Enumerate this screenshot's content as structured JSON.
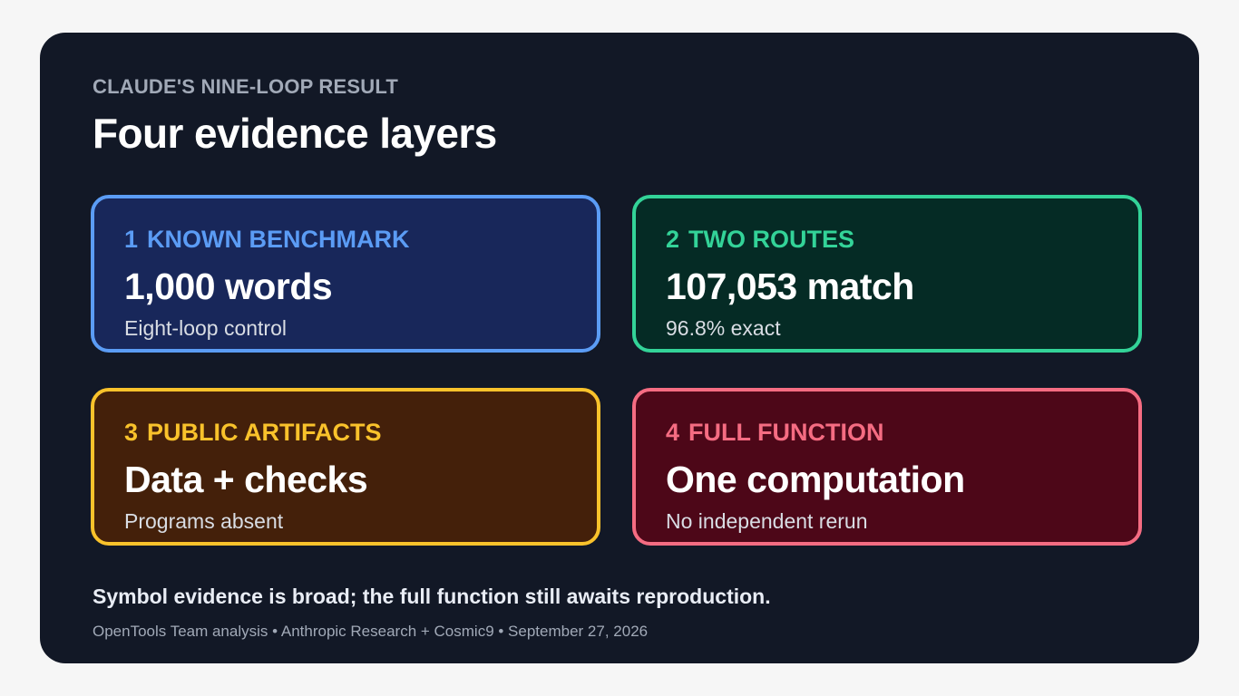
{
  "header": {
    "eyebrow": "CLAUDE'S NINE-LOOP RESULT",
    "title": "Four evidence layers"
  },
  "cards": [
    {
      "number": "1",
      "label": "KNOWN BENCHMARK",
      "value": "1,000 words",
      "note": "Eight-loop control",
      "accent": "#5b9cf5"
    },
    {
      "number": "2",
      "label": "TWO ROUTES",
      "value": "107,053 match",
      "note": "96.8% exact",
      "accent": "#33d398"
    },
    {
      "number": "3",
      "label": "PUBLIC ARTIFACTS",
      "value": "Data + checks",
      "note": "Programs absent",
      "accent": "#f9c22b"
    },
    {
      "number": "4",
      "label": "FULL FUNCTION",
      "value": "One computation",
      "note": "No independent rerun",
      "accent": "#f56c82"
    }
  ],
  "conclusion": "Symbol evidence is broad; the full function still awaits reproduction.",
  "footer": "OpenTools Team analysis • Anthropic Research + Cosmic9 • September 27, 2026"
}
